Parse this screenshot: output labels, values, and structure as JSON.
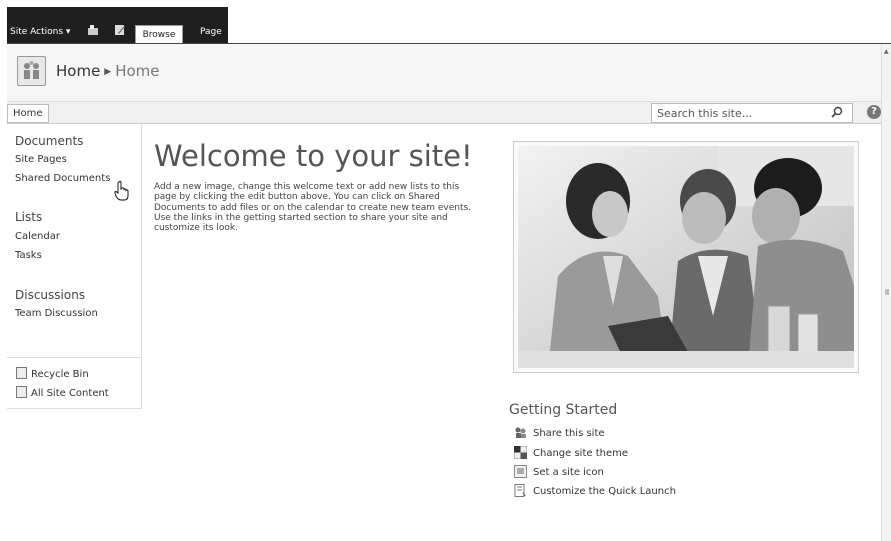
{
  "ribbon": {
    "site_actions": "Site Actions ▾",
    "tabs": [
      "Browse",
      "Page"
    ]
  },
  "title_area": {
    "breadcrumb": [
      "Home",
      "Home"
    ]
  },
  "topnav": {
    "home_tab": "Home",
    "search_placeholder": "Search this site..."
  },
  "quick_launch": {
    "sections": [
      {
        "heading": "Documents",
        "items": [
          "Site Pages",
          "Shared Documents"
        ]
      },
      {
        "heading": "Lists",
        "items": [
          "Calendar",
          "Tasks"
        ]
      },
      {
        "heading": "Discussions",
        "items": [
          "Team Discussion"
        ]
      }
    ],
    "utility": [
      "Recycle Bin",
      "All Site Content"
    ]
  },
  "main": {
    "title": "Welcome to your site!",
    "body": "Add a new image, change this welcome text or add new lists to this page by clicking the edit button above. You can click on Shared Documents to add files or on the calendar to create new team events. Use the links in the getting started section to share your site and customize its look."
  },
  "getting_started": {
    "title": "Getting Started",
    "items": [
      "Share this site",
      "Change site theme",
      "Set a site icon",
      "Customize the Quick Launch"
    ]
  },
  "icons": {
    "help": "?"
  }
}
